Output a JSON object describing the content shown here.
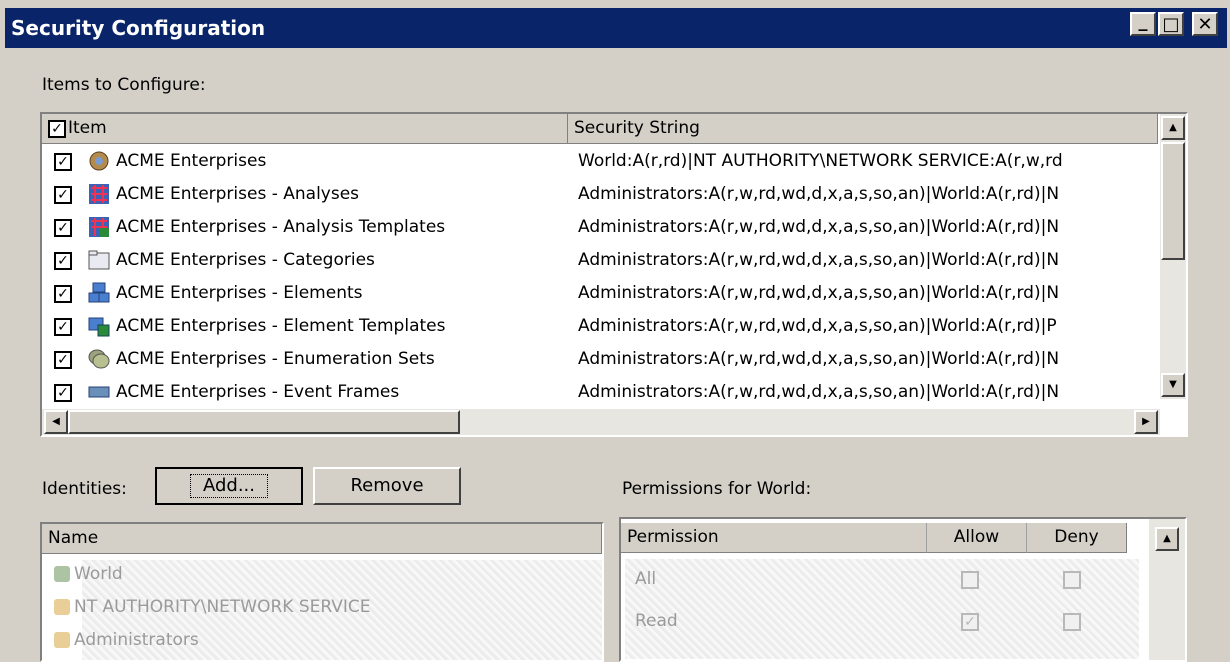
{
  "window": {
    "title": "Security Configuration",
    "controls": {
      "minimize": "_",
      "maximize": "□",
      "close": "✕"
    }
  },
  "items_label": "Items to Configure:",
  "items_table": {
    "columns": [
      "Item",
      "Security String"
    ],
    "rows": [
      {
        "icon": "database-icon",
        "name": "ACME Enterprises",
        "security": "World:A(r,rd)|NT AUTHORITY\\NETWORK SERVICE:A(r,w,rd"
      },
      {
        "icon": "analyses-icon",
        "name": "ACME Enterprises - Analyses",
        "security": "Administrators:A(r,w,rd,wd,d,x,a,s,so,an)|World:A(r,rd)|N"
      },
      {
        "icon": "analysis-templates-icon",
        "name": "ACME Enterprises - Analysis Templates",
        "security": "Administrators:A(r,w,rd,wd,d,x,a,s,so,an)|World:A(r,rd)|N"
      },
      {
        "icon": "folder-icon",
        "name": "ACME Enterprises - Categories",
        "security": "Administrators:A(r,w,rd,wd,d,x,a,s,so,an)|World:A(r,rd)|N"
      },
      {
        "icon": "elements-icon",
        "name": "ACME Enterprises - Elements",
        "security": "Administrators:A(r,w,rd,wd,d,x,a,s,so,an)|World:A(r,rd)|N"
      },
      {
        "icon": "element-templates-icon",
        "name": "ACME Enterprises - Element Templates",
        "security": "Administrators:A(r,w,rd,wd,d,x,a,s,so,an)|World:A(r,rd)|P"
      },
      {
        "icon": "enumeration-sets-icon",
        "name": "ACME Enterprises - Enumeration Sets",
        "security": "Administrators:A(r,w,rd,wd,d,x,a,s,so,an)|World:A(r,rd)|N"
      },
      {
        "icon": "event-frames-icon",
        "name": "ACME Enterprises - Event Frames",
        "security": "Administrators:A(r,w,rd,wd,d,x,a,s,so,an)|World:A(r,rd)|N"
      }
    ]
  },
  "identities": {
    "label": "Identities:",
    "add_button": "Add...",
    "remove_button": "Remove",
    "column": "Name",
    "rows": [
      "World",
      "NT AUTHORITY\\NETWORK SERVICE",
      "Administrators"
    ]
  },
  "permissions": {
    "label": "Permissions for World:",
    "columns": [
      "Permission",
      "Allow",
      "Deny"
    ],
    "rows": [
      {
        "name": "All",
        "allow": false,
        "deny": false
      },
      {
        "name": "Read",
        "allow": true,
        "deny": false
      }
    ]
  }
}
